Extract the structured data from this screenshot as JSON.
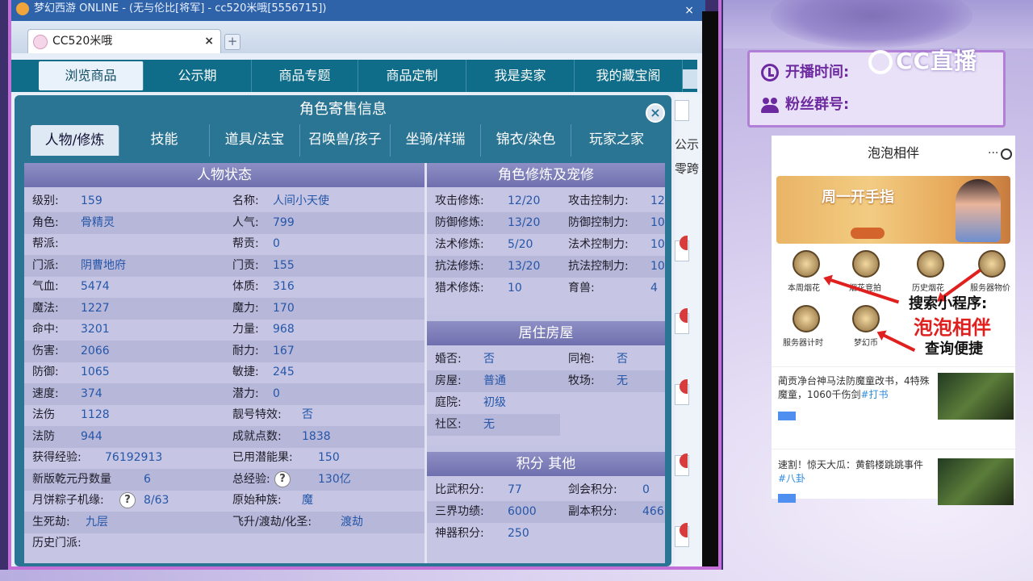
{
  "window": {
    "title": "梦幻西游 ONLINE - (无与伦比[将军] - cc520米哦[5556715])"
  },
  "browser": {
    "tab_label": "CC520米哦",
    "tab_close": "×",
    "new_tab": "+"
  },
  "site_nav": {
    "items": [
      "浏览商品",
      "公示期",
      "商品专题",
      "商品定制",
      "我是卖家",
      "我的藏宝阁"
    ]
  },
  "page_right_strip": {
    "text1": "公示",
    "text2": "零跨"
  },
  "dialog": {
    "title": "角色寄售信息",
    "close": "×",
    "tabs": [
      "人物/修炼",
      "技能",
      "道具/法宝",
      "召唤兽/孩子",
      "坐骑/祥瑞",
      "锦衣/染色",
      "玩家之家"
    ]
  },
  "char_status": {
    "title": "人物状态",
    "left": [
      {
        "label": "级别:",
        "value": "159"
      },
      {
        "label": "角色:",
        "value": "骨精灵"
      },
      {
        "label": "帮派:",
        "value": ""
      },
      {
        "label": "门派:",
        "value": "阴曹地府"
      },
      {
        "label": "气血:",
        "value": "5474"
      },
      {
        "label": "魔法:",
        "value": "1227"
      },
      {
        "label": "命中:",
        "value": "3201"
      },
      {
        "label": "伤害:",
        "value": "2066"
      },
      {
        "label": "防御:",
        "value": "1065"
      },
      {
        "label": "速度:",
        "value": "374"
      },
      {
        "label": "法伤",
        "value": "1128"
      },
      {
        "label": "法防",
        "value": "944"
      }
    ],
    "right": [
      {
        "label": "名称:",
        "value": "人间小天使"
      },
      {
        "label": "人气:",
        "value": "799"
      },
      {
        "label": "帮贡:",
        "value": "0"
      },
      {
        "label": "门贡:",
        "value": "155"
      },
      {
        "label": "体质:",
        "value": "316"
      },
      {
        "label": "魔力:",
        "value": "170"
      },
      {
        "label": "力量:",
        "value": "968"
      },
      {
        "label": "耐力:",
        "value": "167"
      },
      {
        "label": "敏捷:",
        "value": "245"
      },
      {
        "label": "潜力:",
        "value": "0"
      },
      {
        "label": "靓号特效:",
        "value": "否"
      },
      {
        "label": "成就点数:",
        "value": "1838"
      }
    ],
    "extra_left": [
      {
        "label": "获得经验:",
        "value": "76192913"
      },
      {
        "label": "新版乾元丹数量",
        "value": "6"
      },
      {
        "label": "月饼粽子机缘:",
        "value": "8/63"
      },
      {
        "label": "生死劫:",
        "value": "九层"
      },
      {
        "label": "历史门派:",
        "value": ""
      }
    ],
    "extra_right": [
      {
        "label": "已用潜能果:",
        "value": "150"
      },
      {
        "label": "总经验:",
        "value": "130亿"
      },
      {
        "label": "原始种族:",
        "value": "魔"
      },
      {
        "label": "飞升/渡劫/化圣:",
        "value": "渡劫"
      }
    ],
    "help_mark": "?"
  },
  "cultivation": {
    "title": "角色修炼及宠修",
    "left": [
      {
        "label": "攻击修炼:",
        "value": "12/20"
      },
      {
        "label": "防御修炼:",
        "value": "13/20"
      },
      {
        "label": "法术修炼:",
        "value": "5/20"
      },
      {
        "label": "抗法修炼:",
        "value": "13/20"
      },
      {
        "label": "猎术修炼:",
        "value": "10"
      }
    ],
    "right": [
      {
        "label": "攻击控制力:",
        "value": "12"
      },
      {
        "label": "防御控制力:",
        "value": "10"
      },
      {
        "label": "法术控制力:",
        "value": "10"
      },
      {
        "label": "抗法控制力:",
        "value": "10"
      },
      {
        "label": "育兽:",
        "value": "4"
      }
    ]
  },
  "housing": {
    "title": "居住房屋",
    "left": [
      {
        "label": "婚否:",
        "value": "否"
      },
      {
        "label": "房屋:",
        "value": "普通"
      },
      {
        "label": "庭院:",
        "value": "初级"
      },
      {
        "label": "社区:",
        "value": "无"
      }
    ],
    "right": [
      {
        "label": "同袍:",
        "value": "否"
      },
      {
        "label": "牧场:",
        "value": "无"
      }
    ]
  },
  "points": {
    "title": "积分 其他",
    "left": [
      {
        "label": "比武积分:",
        "value": "77"
      },
      {
        "label": "三界功绩:",
        "value": "6000"
      },
      {
        "label": "神器积分:",
        "value": "250"
      }
    ],
    "right": [
      {
        "label": "剑会积分:",
        "value": "0"
      },
      {
        "label": "副本积分:",
        "value": "466"
      }
    ]
  },
  "overlay": {
    "live_time_label": "开播时间:",
    "fan_group_label": "粉丝群号:",
    "logo_text": "CC直播"
  },
  "phone": {
    "title": "泡泡相伴",
    "menu": "···",
    "banner_text": "周一开手指",
    "icons": [
      "本周烟花",
      "烟花竞拍",
      "历史烟花",
      "服务器物价",
      "服务器计时",
      "梦幻币"
    ],
    "callout1": "搜索小程序:",
    "callout2": "泡泡相伴",
    "callout3": "查询便捷",
    "news": [
      {
        "text": "蔺贡净台神马法防魔童改书，4特殊魔童，1060千伤剑",
        "tag": "#打书"
      },
      {
        "text": "速割！惊天大瓜：黄鹤楼跳跳事件",
        "tag": "#八卦"
      }
    ]
  },
  "colors": {
    "nav_bg": "#0f6d8a",
    "dialog_bg": "#2a7494",
    "value_blue": "#2556a8",
    "callout_red": "#e0201e",
    "overlay_purple": "#6d2aa0"
  }
}
